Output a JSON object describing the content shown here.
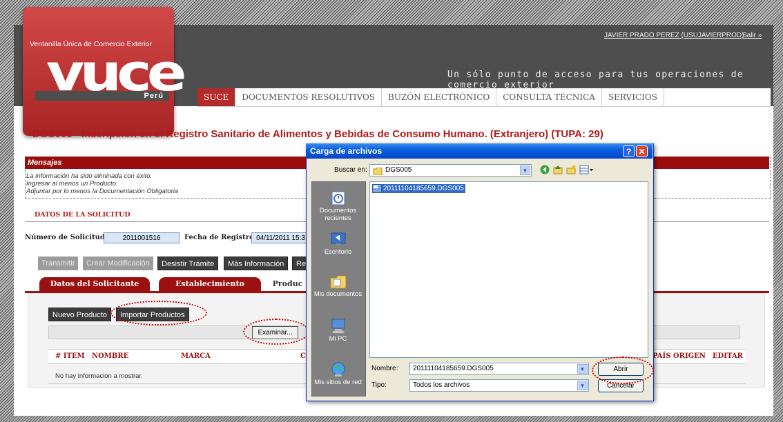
{
  "header": {
    "brand_sub": "Ventanilla Única de Comercio Exterior",
    "brand_logo": "vuce",
    "brand_country": "Perú",
    "user": "JAVIER PRADO PEREZ (USUJAVIERPROD)",
    "logout": "Salir »",
    "tagline": "Un sólo punto de acceso para tus operaciones de comercio exterior"
  },
  "nav": [
    "SUCE",
    "DOCUMENTOS RESOLUTIVOS",
    "BUZÓN ELECTRÓNICO",
    "CONSULTA TÉCNICA",
    "SERVICIOS"
  ],
  "page_title": "DGS005 - Inscripción en el Registro Sanitario de Alimentos y Bebidas de Consumo Humano. (Extranjero) (TUPA: 29)",
  "messages": {
    "title": "Mensajes",
    "lines": [
      "La información ha sido eliminada con éxito.",
      "Ingresar al menos un Producto.",
      "Adjuntar por lo menos la Documentación Obligatoria"
    ]
  },
  "section": {
    "title": "DATOS DE LA SOLICITUD",
    "request_label": "Número de Solicitud:",
    "request_value": "2011001516",
    "date_label": "Fecha de Registro:",
    "date_value": "04/11/2011 15:3"
  },
  "actions": {
    "transmit": "Transmitir",
    "create_mod": "Crear Modificación",
    "desist": "Desistir Trámite",
    "more_info": "Más Información",
    "re": "Re"
  },
  "tabs": [
    "Datos del Solicitante",
    "Establecimiento",
    "Produc"
  ],
  "products": {
    "new": "Nuevo Producto",
    "import": "Importar Productos",
    "browse": "Examinar..."
  },
  "table": {
    "headers": [
      "# ITEM",
      "NOMBRE",
      "MARCA",
      "C",
      "PAÍS ORIGEN",
      "EDITAR"
    ],
    "empty": "No hay informacion a mostrar."
  },
  "dialog": {
    "title": "Carga de archivos",
    "help": "?",
    "close": "✕",
    "look_in_label": "Buscar en:",
    "look_in_value": "DGS005",
    "places": [
      {
        "icon": "recent-documents-icon",
        "label": "Documentos recientes"
      },
      {
        "icon": "desktop-icon",
        "label": "Escritorio"
      },
      {
        "icon": "my-documents-icon",
        "label": "Mis documentos"
      },
      {
        "icon": "my-computer-icon",
        "label": "Mi PC"
      },
      {
        "icon": "network-places-icon",
        "label": "Mis sitios de red"
      }
    ],
    "file": "20111104185659.DGS005",
    "name_label": "Nombre:",
    "name_value": "20111104185659.DGS005",
    "type_label": "Tipo:",
    "type_value": "Todos los archivos",
    "open": "Abrir",
    "cancel": "Cancelar"
  },
  "colors": {
    "accent": "#9b1010",
    "header": "#4e4e4e",
    "dialog_title": "#0a5ee0"
  }
}
